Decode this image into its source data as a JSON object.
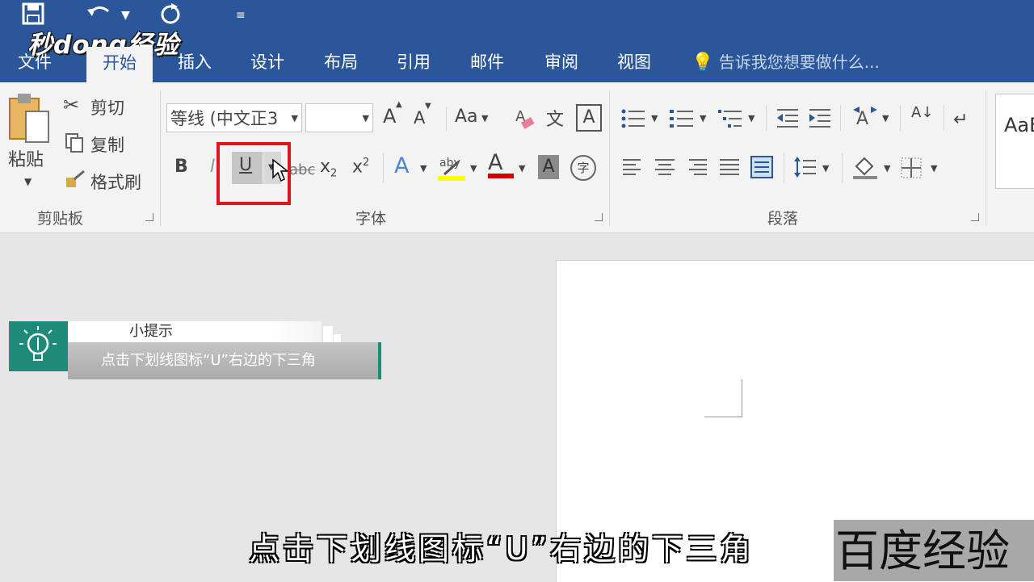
{
  "brand": "秒dong经验",
  "qat": {
    "save_icon": "save-icon",
    "undo_icon": "undo-icon",
    "redo_icon": "redo-icon",
    "customize_icon": "customize-icon"
  },
  "tabs": [
    {
      "label": "文件"
    },
    {
      "label": "开始"
    },
    {
      "label": "插入"
    },
    {
      "label": "设计"
    },
    {
      "label": "布局"
    },
    {
      "label": "引用"
    },
    {
      "label": "邮件"
    },
    {
      "label": "审阅"
    },
    {
      "label": "视图"
    }
  ],
  "tell_me": {
    "placeholder": "告诉我您想要做什么..."
  },
  "clipboard": {
    "paste_label": "粘贴",
    "cut_label": "剪切",
    "copy_label": "复制",
    "format_painter_label": "格式刷",
    "group_label": "剪贴板"
  },
  "font": {
    "font_name": "等线 (中文正3",
    "font_size": "",
    "grow_label": "A",
    "shrink_label": "A",
    "change_case_label": "Aa",
    "phonetic_label": "文",
    "border_label": "A",
    "bold_label": "B",
    "italic_label": "I",
    "underline_label": "U",
    "strike_label": "abc",
    "subscript_label": "x",
    "subscript_mark": "2",
    "superscript_label": "x",
    "superscript_mark": "2",
    "effects_label": "A",
    "highlight_label": "aby",
    "color_label": "A",
    "shading_label": "A",
    "enclose_label": "字",
    "group_label": "字体"
  },
  "paragraph": {
    "group_label": "段落",
    "sort_label": "A↓"
  },
  "styles": {
    "preview": "AaB"
  },
  "tip": {
    "title": "小提示",
    "text": "点击下划线图标“U”右边的下三角"
  },
  "subtitle": "点击下划线图标“U”右边的下三角",
  "watermark": "百度经验",
  "colors": {
    "accent": "#2b579a",
    "highlight_box": "#e2141c",
    "tip_green": "#1d8a7a",
    "highlighter": "#ffff00",
    "font_color": "#d00000"
  }
}
